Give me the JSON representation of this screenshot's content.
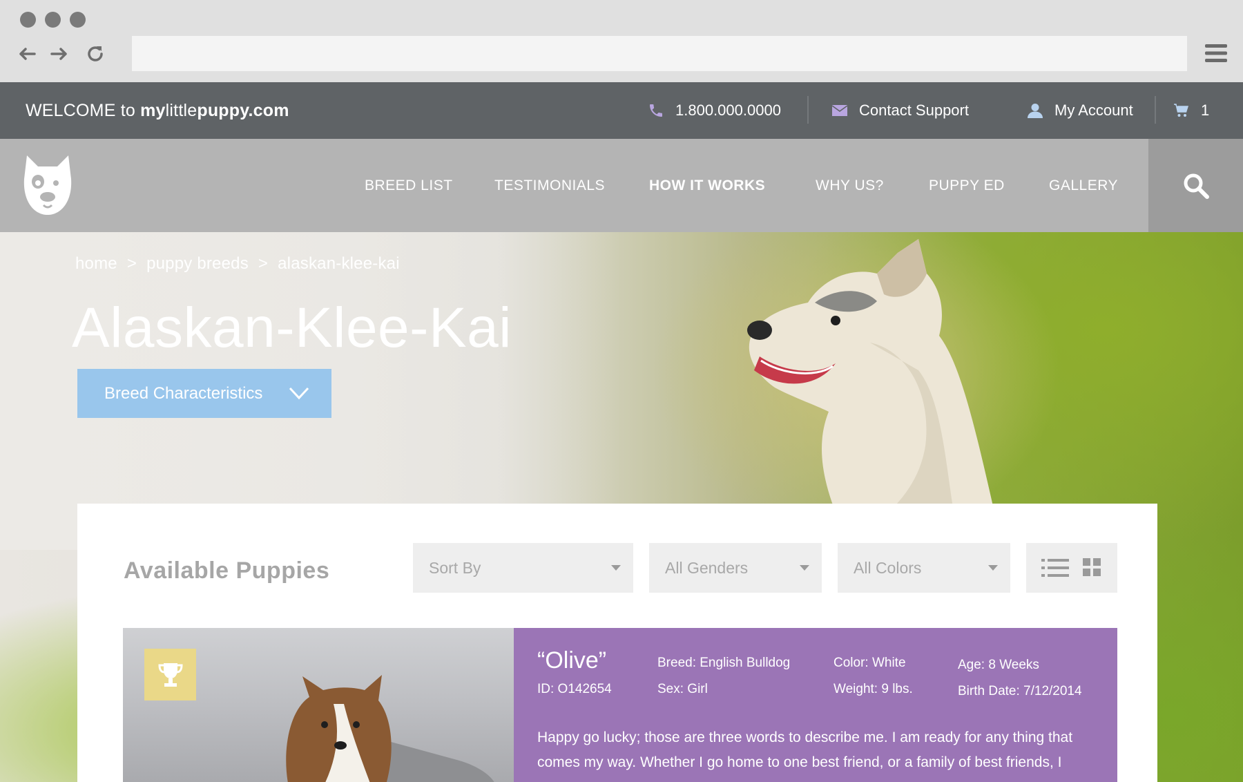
{
  "browser": {
    "url_value": "",
    "menu_icon": "hamburger-icon"
  },
  "topbar": {
    "welcome_prefix": "WELCOME to ",
    "site_my": "my",
    "site_little": "little",
    "site_puppy": "puppy.com",
    "phone": "1.800.000.0000",
    "contact": "Contact Support",
    "account": "My Account",
    "cart_count": "1"
  },
  "nav": {
    "items": [
      {
        "label": "BREED LIST",
        "active": false
      },
      {
        "label": "TESTIMONIALS",
        "active": false
      },
      {
        "label": "HOW IT WORKS",
        "active": true
      },
      {
        "label": "WHY US?",
        "active": false
      },
      {
        "label": "PUPPY ED",
        "active": false
      },
      {
        "label": "GALLERY",
        "active": false
      }
    ]
  },
  "hero": {
    "breadcrumb": [
      "home",
      "puppy breeds",
      "alaskan-klee-kai"
    ],
    "breadcrumb_sep": ">",
    "title": "Alaskan-Klee-Kai",
    "button_label": "Breed Characteristics"
  },
  "listing_section": {
    "title": "Available Puppies",
    "filters": {
      "sort": "Sort By",
      "gender": "All Genders",
      "color": "All Colors"
    }
  },
  "puppy": {
    "name": "“Olive”",
    "id": "ID: O142654",
    "breed": "Breed: English Bulldog",
    "sex": "Sex: Girl",
    "color": "Color: White",
    "weight": "Weight: 9 lbs.",
    "age": "Age: 8 Weeks",
    "birth": "Birth Date: 7/12/2014",
    "description": "Happy go lucky; those are three words to describe me. I am ready for any thing that comes my way. Whether I go home to one best friend, or a family of best friends, I"
  },
  "colors": {
    "topbar": "#5f6366",
    "nav": "#b4b4b4",
    "accent_blue": "#99c6ec",
    "listing_purple": "#9b75b6",
    "trophy_gold": "#ead888",
    "icon_lavender": "#b9a6e0"
  }
}
